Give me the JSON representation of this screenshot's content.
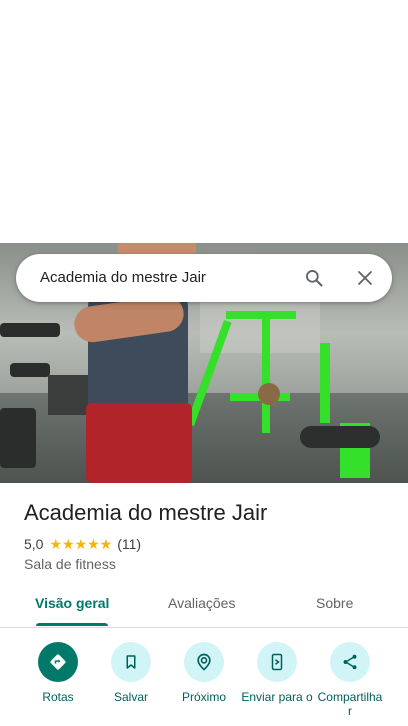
{
  "search": {
    "query": "Academia do mestre Jair"
  },
  "place": {
    "name": "Academia do mestre Jair",
    "rating": "5,0",
    "stars": "★★★★★",
    "review_count": "(11)",
    "category": "Sala de fitness"
  },
  "tabs": [
    {
      "label": "Visão geral",
      "active": true
    },
    {
      "label": "Avaliações",
      "active": false
    },
    {
      "label": "Sobre",
      "active": false
    }
  ],
  "actions": [
    {
      "label": "Rotas",
      "icon": "directions-icon"
    },
    {
      "label": "Salvar",
      "icon": "bookmark-icon"
    },
    {
      "label": "Próximo",
      "icon": "nearby-icon"
    },
    {
      "label": "Enviar para o",
      "icon": "send-to-phone-icon"
    },
    {
      "label": "Compartilha r",
      "icon": "share-icon"
    }
  ],
  "colors": {
    "accent": "#00796b",
    "action_bg": "#d1f4f7",
    "star": "#f7b400"
  }
}
